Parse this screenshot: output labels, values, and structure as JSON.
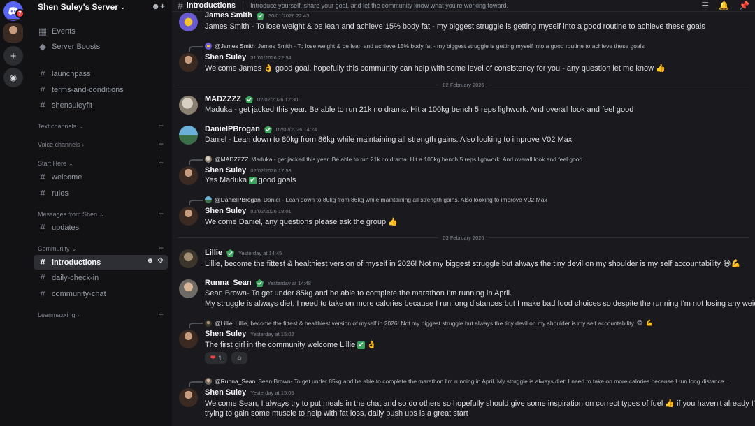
{
  "rail": {
    "notification_count": "7"
  },
  "server": {
    "name": "Shen Suley's Server"
  },
  "sidebar": {
    "top_items": [
      {
        "label": "Events"
      },
      {
        "label": "Server Boosts"
      }
    ],
    "channels_top": [
      {
        "label": "launchpass"
      },
      {
        "label": "terms-and-conditions"
      },
      {
        "label": "shensuleyfit"
      }
    ],
    "categories": {
      "text_channels": "Text channels",
      "voice_channels": "Voice channels",
      "start_here": "Start Here",
      "messages_from_shen": "Messages from Shen",
      "community": "Community",
      "leanmaxxing": "Leanmaxxing"
    },
    "start_here_channels": [
      {
        "label": "welcome"
      },
      {
        "label": "rules"
      }
    ],
    "messages_channels": [
      {
        "label": "updates"
      }
    ],
    "community_channels": [
      {
        "label": "introductions"
      },
      {
        "label": "daily-check-in"
      },
      {
        "label": "community-chat"
      }
    ]
  },
  "topbar": {
    "channel_name": "introductions",
    "topic": "Introduce yourself, share your goal, and let the community know what you're working toward."
  },
  "messages": [
    {
      "author": "James Smith",
      "time": "30/01/2026 22:43",
      "text": "James Smith - To lose weight & be lean and achieve 15% body fat - my biggest struggle is getting myself into a good routine to achieve these goals"
    },
    {
      "reply_author": "@James Smith",
      "reply_text": "James Smith - To lose weight & be lean and achieve 15% body fat - my biggest struggle is getting myself into a good routine to achieve these goals",
      "author": "Shen Suley",
      "time": "31/01/2026 22:54",
      "text_a": "Welcome James",
      "text_b": "good goal, hopefully this community can help with some level of consistency for you - any question let me know"
    },
    {
      "author": "MADZZZZ",
      "time": "02/02/2026 12:30",
      "text": "Maduka - get jacked this year. Be able to run 21k no drama. Hit a 100kg bench 5 reps lighwork. And overall look and feel good"
    },
    {
      "author": "DanielPBrogan",
      "time": "02/02/2026 14:24",
      "text": "Daniel - Lean down to 80kg from 86kg while maintaining all strength gains. Also looking to improve V02 Max"
    },
    {
      "reply_author": "@MADZZZZ",
      "reply_text": "Maduka - get jacked this year. Be able to run 21k no drama. Hit a 100kg bench 5 reps lighwork. And overall look and feel good",
      "author": "Shen Suley",
      "time": "02/02/2026 17:58",
      "text_a": "Yes Maduka",
      "text_b": "good goals"
    },
    {
      "reply_author": "@DanielPBrogan",
      "reply_text": "Daniel - Lean down to 80kg from 86kg while maintaining all strength gains. Also looking to improve V02 Max",
      "author": "Shen Suley",
      "time": "02/02/2026 18:01",
      "text": "Welcome Daniel, any questions please ask the group"
    },
    {
      "author": "Lillie",
      "time": "Yesterday at 14:45",
      "text": "Lillie, become the fittest & healthiest version of myself in 2026! Not my biggest struggle but always the tiny devil on my shoulder is my self accountability"
    },
    {
      "author": "Runna_Sean",
      "time": "Yesterday at 14:48",
      "text_1": "Sean Brown- To get under 85kg and be able to complete the marathon I'm running in April.",
      "text_2": "My struggle is always diet: I need to take on more calories because I run long distances but I make bad food choices so despite the running I'm not losing any weight."
    },
    {
      "reply_author": "@Lillie",
      "reply_text": "Lillie, become the fittest & healthiest version of myself in 2026! Not my biggest struggle but always the tiny devil on my shoulder is my self accountability",
      "author": "Shen Suley",
      "time": "Yesterday at 15:02",
      "text": "The first girl in the community welcome Lillie",
      "reaction_count": "1"
    },
    {
      "reply_author": "@Runna_Sean",
      "reply_text": "Sean Brown- To get under 85kg and be able to complete the marathon I'm running in April.  My struggle is always diet: I need to take on more calories because I run long distance...",
      "author": "Shen Suley",
      "time": "Yesterday at 15:05",
      "text_1a": "Welcome Sean, I always try to put meals in the chat and so do others so hopefully should give some inspiration on correct types of fuel",
      "text_1b": "if you haven't already I'd start",
      "text_2": "trying to gain some muscle to help with fat loss, daily push ups is a great start"
    }
  ],
  "dividers": {
    "d1": "02 February 2026",
    "d2": "03 February 2026"
  }
}
